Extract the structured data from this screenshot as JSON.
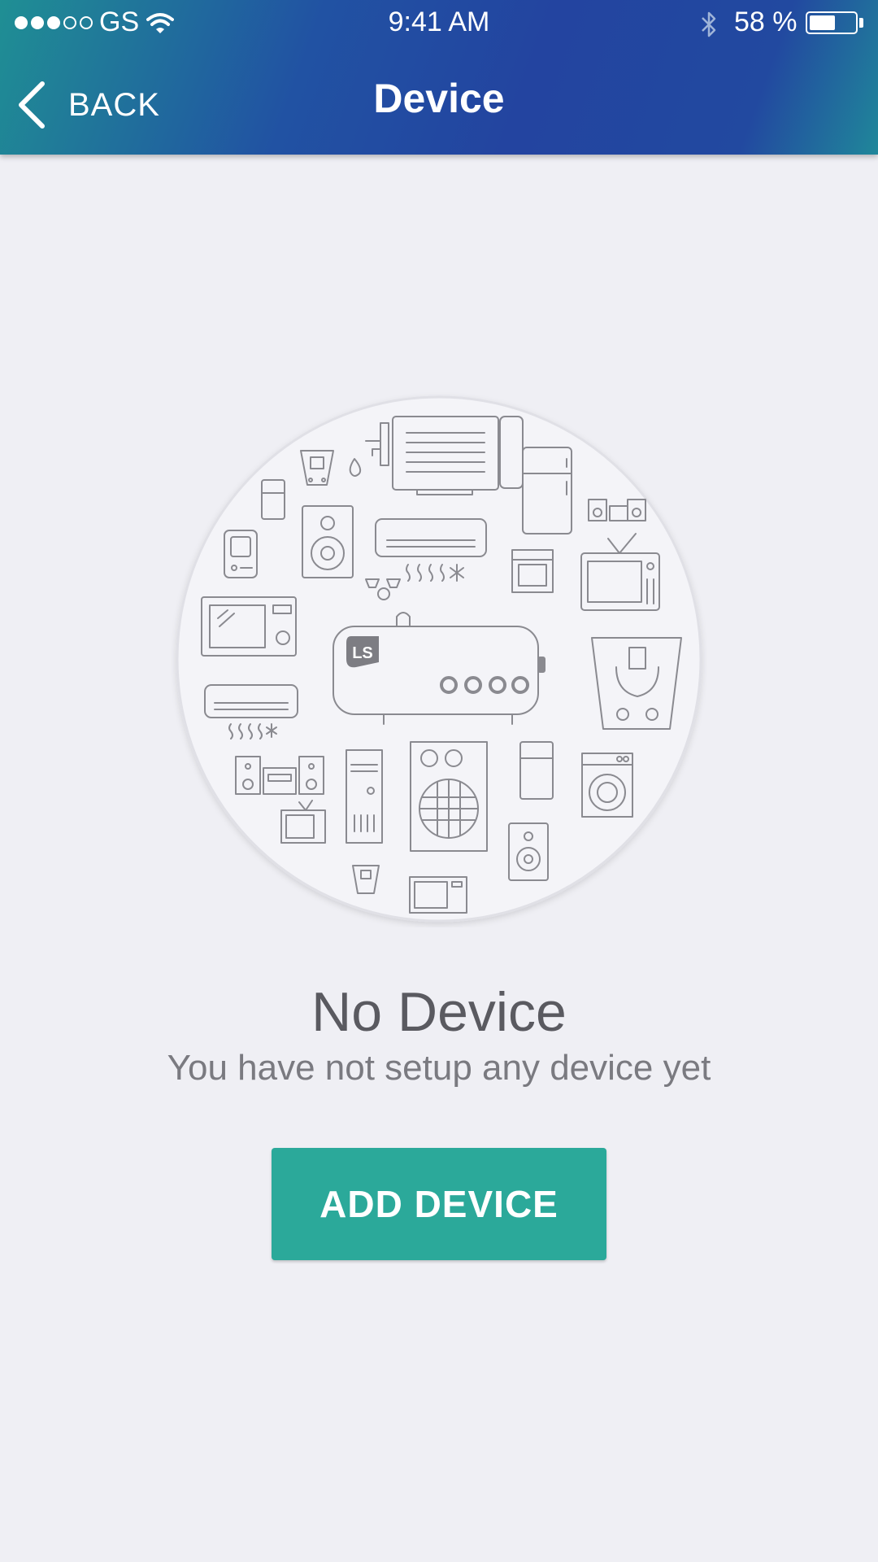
{
  "status_bar": {
    "carrier": "GS",
    "time": "9:41 AM",
    "battery_percent": "58 %",
    "battery_level": 0.58,
    "signal_bars_filled": 3,
    "signal_bars_total": 5
  },
  "nav": {
    "back_label": "BACK",
    "title": "Device"
  },
  "illustration": {
    "brand_badge": "LS"
  },
  "empty_state": {
    "title": "No Device",
    "subtitle": "You have not setup any device yet"
  },
  "actions": {
    "add_device_label": "ADD DEVICE"
  },
  "colors": {
    "header_start": "#1f8f94",
    "header_mid": "#2249a0",
    "accent": "#2ba99a",
    "background": "#efeff4"
  }
}
